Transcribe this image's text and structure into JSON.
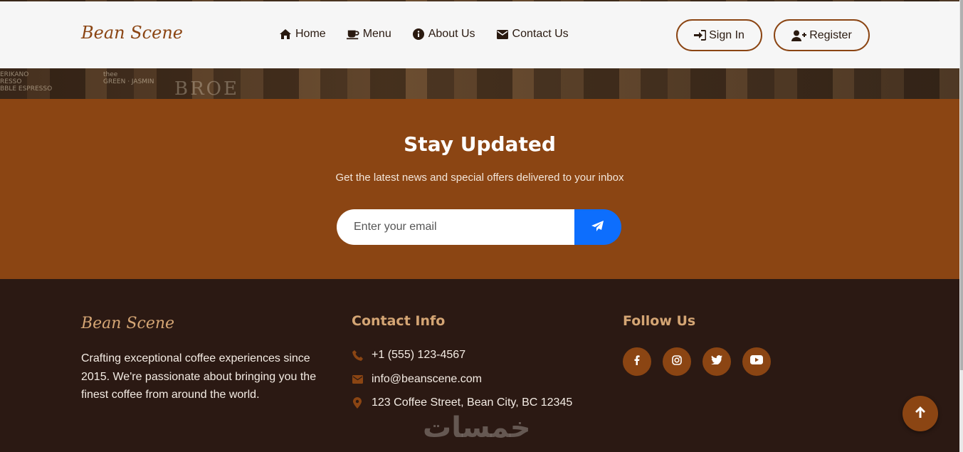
{
  "navbar": {
    "brand": "Bean Scene",
    "links": [
      {
        "label": "Home",
        "icon": "home-icon"
      },
      {
        "label": "Menu",
        "icon": "mug-icon"
      },
      {
        "label": "About Us",
        "icon": "info-icon"
      },
      {
        "label": "Contact Us",
        "icon": "envelope-icon"
      }
    ],
    "signin_label": "Sign In",
    "register_label": "Register"
  },
  "newsletter": {
    "title": "Stay Updated",
    "subtitle": "Get the latest news and special offers delivered to your inbox",
    "email_placeholder": "Enter your email",
    "send_icon": "paper-plane-icon"
  },
  "footer": {
    "brand": "Bean Scene",
    "description": "Crafting exceptional coffee experiences since 2015. We're passionate about bringing you the finest coffee from around the world.",
    "contact_heading": "Contact Info",
    "contact": {
      "phone": "+1 (555) 123-4567",
      "email": "info@beanscene.com",
      "address": "123 Coffee Street, Bean City, BC 12345"
    },
    "follow_heading": "Follow Us",
    "social": [
      "facebook-icon",
      "instagram-icon",
      "twitter-icon",
      "youtube-icon"
    ]
  },
  "watermark": "خمسات",
  "colors": {
    "brand_brown": "#8b4513",
    "footer_bg": "#2b1913",
    "accent_tan": "#d4a574",
    "send_blue": "#0d6efd"
  }
}
